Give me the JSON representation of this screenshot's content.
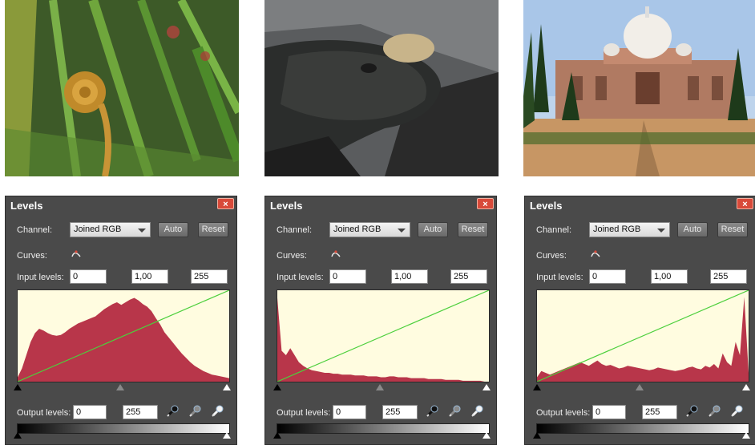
{
  "photos": [
    {
      "subject": "fern-fiddlehead"
    },
    {
      "subject": "lizard-on-rock"
    },
    {
      "subject": "humayun-tomb"
    }
  ],
  "panels": [
    {
      "title": "Levels",
      "close_label": "×",
      "channel_label": "Channel:",
      "channel_value": "Joined RGB",
      "auto_label": "Auto",
      "reset_label": "Reset",
      "curves_label": "Curves:",
      "input_levels_label": "Input levels:",
      "input_black": "0",
      "input_gamma": "1,00",
      "input_white": "255",
      "output_levels_label": "Output levels:",
      "output_black": "0",
      "output_white": "255",
      "histogram": [
        0.05,
        0.15,
        0.3,
        0.45,
        0.55,
        0.6,
        0.58,
        0.55,
        0.53,
        0.52,
        0.53,
        0.56,
        0.6,
        0.63,
        0.66,
        0.68,
        0.7,
        0.72,
        0.74,
        0.78,
        0.82,
        0.85,
        0.88,
        0.9,
        0.87,
        0.9,
        0.93,
        0.95,
        0.92,
        0.88,
        0.85,
        0.8,
        0.72,
        0.65,
        0.56,
        0.5,
        0.44,
        0.38,
        0.32,
        0.27,
        0.22,
        0.18,
        0.15,
        0.12,
        0.1,
        0.08,
        0.07,
        0.06,
        0.05,
        0.04
      ]
    },
    {
      "title": "Levels",
      "close_label": "×",
      "channel_label": "Channel:",
      "channel_value": "Joined RGB",
      "auto_label": "Auto",
      "reset_label": "Reset",
      "curves_label": "Curves:",
      "input_levels_label": "Input levels:",
      "input_black": "0",
      "input_gamma": "1,00",
      "input_white": "255",
      "output_levels_label": "Output levels:",
      "output_black": "0",
      "output_white": "255",
      "histogram": [
        0.95,
        0.35,
        0.3,
        0.38,
        0.3,
        0.22,
        0.18,
        0.15,
        0.13,
        0.12,
        0.11,
        0.1,
        0.1,
        0.09,
        0.09,
        0.08,
        0.08,
        0.08,
        0.07,
        0.07,
        0.07,
        0.06,
        0.06,
        0.06,
        0.05,
        0.05,
        0.06,
        0.06,
        0.05,
        0.05,
        0.05,
        0.04,
        0.04,
        0.04,
        0.04,
        0.03,
        0.03,
        0.03,
        0.03,
        0.02,
        0.02,
        0.02,
        0.02,
        0.01,
        0.01,
        0.01,
        0.01,
        0.01,
        0.0,
        0.0
      ]
    },
    {
      "title": "Levels",
      "close_label": "×",
      "channel_label": "Channel:",
      "channel_value": "Joined RGB",
      "auto_label": "Auto",
      "reset_label": "Reset",
      "curves_label": "Curves:",
      "input_levels_label": "Input levels:",
      "input_black": "0",
      "input_gamma": "1,00",
      "input_white": "255",
      "output_levels_label": "Output levels:",
      "output_black": "0",
      "output_white": "255",
      "histogram": [
        0.05,
        0.12,
        0.1,
        0.08,
        0.1,
        0.12,
        0.14,
        0.16,
        0.18,
        0.2,
        0.22,
        0.2,
        0.18,
        0.21,
        0.24,
        0.2,
        0.18,
        0.19,
        0.17,
        0.15,
        0.16,
        0.18,
        0.17,
        0.16,
        0.15,
        0.14,
        0.13,
        0.14,
        0.16,
        0.15,
        0.14,
        0.13,
        0.12,
        0.13,
        0.14,
        0.16,
        0.17,
        0.15,
        0.14,
        0.18,
        0.16,
        0.2,
        0.15,
        0.32,
        0.22,
        0.18,
        0.45,
        0.3,
        0.96,
        0.1
      ]
    }
  ],
  "colors": {
    "histogram_fill": "#b8364a",
    "histogram_bg": "#fffce0",
    "curve_line": "#4ccf3c",
    "panel_bg": "#4a4a4a",
    "close_bg": "#d84a3a"
  }
}
